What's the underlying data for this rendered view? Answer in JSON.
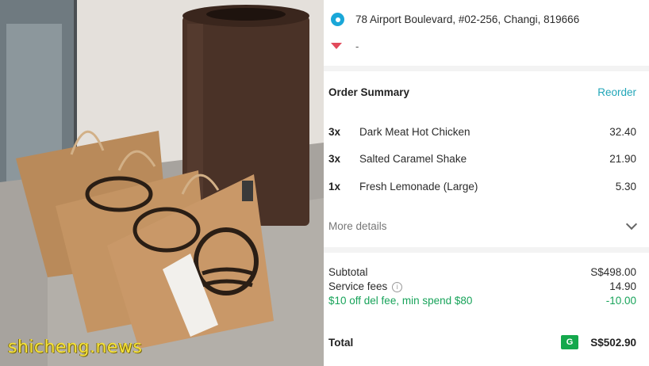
{
  "photo": {
    "watermark": "shicheng.news"
  },
  "delivery": {
    "address": "78 Airport Boulevard, #02-256, Changi, 819666",
    "dropoff": "-",
    "address_icon": "location-pin-icon",
    "dropoff_icon": "dropoff-arrow-icon"
  },
  "order_summary": {
    "title": "Order Summary",
    "reorder_label": "Reorder",
    "items": [
      {
        "qty": "3x",
        "name": "Dark Meat Hot Chicken",
        "price": "32.40"
      },
      {
        "qty": "3x",
        "name": "Salted Caramel Shake",
        "price": "21.90"
      },
      {
        "qty": "1x",
        "name": "Fresh Lemonade (Large)",
        "price": "5.30"
      }
    ],
    "more_details_label": "More details"
  },
  "totals": {
    "subtotal_label": "Subtotal",
    "subtotal_value": "S$498.00",
    "service_fees_label": "Service fees",
    "service_fees_value": "14.90",
    "promo_label": "$10 off del fee, min spend $80",
    "promo_value": "-10.00",
    "total_label": "Total",
    "total_value": "S$502.90",
    "payment_badge": "G"
  },
  "colors": {
    "accent": "#21a6b8",
    "promo_green": "#18a35a",
    "pin_blue": "#1aa7d8",
    "badge_green": "#14a84c"
  }
}
